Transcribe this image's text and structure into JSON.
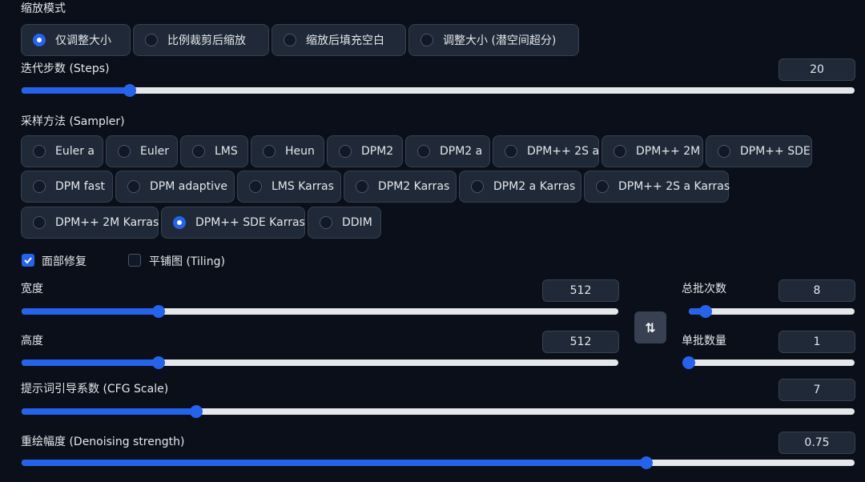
{
  "resize_mode": {
    "label": "缩放模式",
    "options": [
      {
        "label": "仅调整大小",
        "selected": true
      },
      {
        "label": "比例裁剪后缩放",
        "selected": false
      },
      {
        "label": "缩放后填充空白",
        "selected": false
      },
      {
        "label": "调整大小 (潜空间超分)",
        "selected": false
      }
    ]
  },
  "steps": {
    "label": "迭代步数 (Steps)",
    "value": "20",
    "percent": 13
  },
  "sampler": {
    "label": "采样方法 (Sampler)",
    "options": [
      {
        "label": "Euler a",
        "selected": false
      },
      {
        "label": "Euler",
        "selected": false
      },
      {
        "label": "LMS",
        "selected": false
      },
      {
        "label": "Heun",
        "selected": false
      },
      {
        "label": "DPM2",
        "selected": false
      },
      {
        "label": "DPM2 a",
        "selected": false
      },
      {
        "label": "DPM++ 2S a",
        "selected": false
      },
      {
        "label": "DPM++ 2M",
        "selected": false
      },
      {
        "label": "DPM++ SDE",
        "selected": false
      },
      {
        "label": "DPM fast",
        "selected": false
      },
      {
        "label": "DPM adaptive",
        "selected": false
      },
      {
        "label": "LMS Karras",
        "selected": false
      },
      {
        "label": "DPM2 Karras",
        "selected": false
      },
      {
        "label": "DPM2 a Karras",
        "selected": false
      },
      {
        "label": "DPM++ 2S a Karras",
        "selected": false
      },
      {
        "label": "DPM++ 2M Karras",
        "selected": false
      },
      {
        "label": "DPM++ SDE Karras",
        "selected": true
      },
      {
        "label": "DDIM",
        "selected": false
      }
    ]
  },
  "face_restore": {
    "label": "面部修复",
    "checked": true
  },
  "tiling": {
    "label": "平铺图 (Tiling)",
    "checked": false
  },
  "width": {
    "label": "宽度",
    "value": "512",
    "percent": 23
  },
  "height": {
    "label": "高度",
    "value": "512",
    "percent": 23
  },
  "batch_count": {
    "label": "总批次数",
    "value": "8",
    "percent": 10
  },
  "batch_size": {
    "label": "单批数量",
    "value": "1",
    "percent": 0
  },
  "swap": {
    "icon": "swap-vertical-icon",
    "glyph": "⇅"
  },
  "cfg": {
    "label": "提示词引导系数 (CFG Scale)",
    "value": "7",
    "percent": 21
  },
  "denoise": {
    "label": "重绘幅度 (Denoising strength)",
    "value": "0.75",
    "percent": 75
  },
  "colors": {
    "accent": "#2563eb",
    "background": "#0b0f19",
    "panel": "#1f2937"
  }
}
